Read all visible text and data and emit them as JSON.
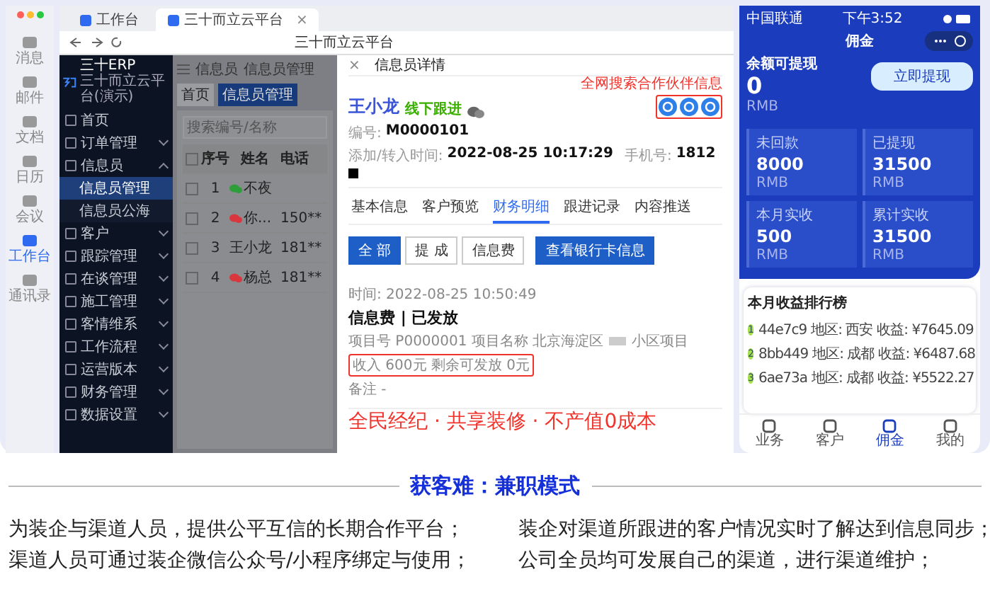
{
  "dock": {
    "items": [
      {
        "label": "消息",
        "selected": false
      },
      {
        "label": "邮件",
        "selected": false
      },
      {
        "label": "文档",
        "selected": false
      },
      {
        "label": "日历",
        "selected": false
      },
      {
        "label": "会议",
        "selected": false
      },
      {
        "label": "工作台",
        "selected": true
      },
      {
        "label": "通讯录",
        "selected": false
      }
    ]
  },
  "browser": {
    "tabs": [
      {
        "label": "工作台",
        "selected": false
      },
      {
        "label": "三十而立云平台",
        "selected": true
      }
    ],
    "tab_close": "×",
    "title": "三十而立云平台"
  },
  "sidebar": {
    "brand": "三十ERP",
    "subtitle": "三十而立云平台(演示)",
    "items": [
      {
        "label": "首页",
        "kind": "link"
      },
      {
        "label": "订单管理",
        "kind": "group",
        "expanded": false
      },
      {
        "label": "信息员",
        "kind": "group",
        "expanded": true,
        "children": [
          {
            "label": "信息员管理",
            "selected": true
          },
          {
            "label": "信息员公海",
            "selected": false
          }
        ]
      },
      {
        "label": "客户",
        "kind": "group",
        "expanded": false
      },
      {
        "label": "跟踪管理",
        "kind": "group",
        "expanded": false
      },
      {
        "label": "在谈管理",
        "kind": "group",
        "expanded": false
      },
      {
        "label": "施工管理",
        "kind": "group",
        "expanded": false
      },
      {
        "label": "客情维系",
        "kind": "group",
        "expanded": false
      },
      {
        "label": "工作流程",
        "kind": "group",
        "expanded": false
      },
      {
        "label": "运营版本",
        "kind": "group",
        "expanded": false
      },
      {
        "label": "财务管理",
        "kind": "group",
        "expanded": false
      },
      {
        "label": "数据设置",
        "kind": "group",
        "expanded": false
      }
    ]
  },
  "content": {
    "breadcrumb": [
      "信息员",
      "信息员管理"
    ],
    "page_tabs": [
      {
        "label": "首页",
        "selected": false
      },
      {
        "label": "信息员管理",
        "selected": true
      }
    ],
    "search": {
      "placeholder": "搜索编号/名称"
    },
    "table": {
      "columns": [
        "序号",
        "姓名",
        "电话"
      ],
      "all_checked": false,
      "rows": [
        {
          "index": "1",
          "name": "不夜",
          "phone": "",
          "color": "#2e9e3a",
          "checked": false
        },
        {
          "index": "2",
          "name": "你...",
          "phone": "150**",
          "color": "#d9363e",
          "checked": false
        },
        {
          "index": "3",
          "name": "王小龙",
          "phone": "181**",
          "checked": false
        },
        {
          "index": "4",
          "name": "杨总",
          "phone": "181**",
          "color": "#d9363e",
          "checked": false
        }
      ]
    }
  },
  "drawer": {
    "title": "信息员详情",
    "close": "×",
    "name": "王小龙",
    "status": "线下跟进",
    "search_note": "全网搜索合作伙伴信息",
    "fields": [
      {
        "label": "编号:",
        "value": "M0000101"
      },
      {
        "label": "添加/转入时间:",
        "value": "2022-08-25 10:17:29"
      },
      {
        "label": "手机号:",
        "value": "1812"
      }
    ],
    "tabs": [
      {
        "label": "基本信息",
        "selected": false
      },
      {
        "label": "客户预览",
        "selected": false
      },
      {
        "label": "财务明细",
        "selected": true
      },
      {
        "label": "跟进记录",
        "selected": false
      },
      {
        "label": "内容推送",
        "selected": false
      }
    ],
    "filters": [
      {
        "label": "全 部",
        "selected": true
      },
      {
        "label": "提 成",
        "selected": false
      },
      {
        "label": "信息费",
        "selected": false
      }
    ],
    "bank_button": "查看银行卡信息",
    "record": {
      "time": "时间: 2022-08-25 10:50:49",
      "title": "信息费 | 已发放",
      "project": "项目号 P0000001  项目名称 北京海淀区",
      "project_type": "小区项目",
      "income": "收入 600元  剩余可发放 0元",
      "note": "备注 -"
    },
    "slogan": "全民经纪 · 共享装修 · 不产值0成本"
  },
  "phone": {
    "carrier": "中国联通",
    "time": "下午3:52",
    "title": "佣金",
    "balance_label": "余额可提现",
    "balance": "0",
    "balance_unit": "RMB",
    "withdraw_button": "立即提现",
    "stats": [
      {
        "label": "未回款",
        "value": "8000",
        "unit": "RMB"
      },
      {
        "label": "已提现",
        "value": "31500",
        "unit": "RMB"
      },
      {
        "label": "本月实收",
        "value": "500",
        "unit": "RMB"
      },
      {
        "label": "累计实收",
        "value": "31500",
        "unit": "RMB"
      }
    ],
    "ranking": {
      "title": "本月收益排行榜",
      "rows": [
        {
          "rank": "1",
          "id": "44e7c9",
          "region": "地区: 西安",
          "income": "收益: ¥7645.09"
        },
        {
          "rank": "2",
          "id": "8bb449",
          "region": "地区: 成都",
          "income": "收益: ¥6487.68"
        },
        {
          "rank": "3",
          "id": "6ae73a",
          "region": "地区: 成都",
          "income": "收益: ¥5522.27"
        }
      ]
    },
    "tabbar": [
      {
        "label": "业务",
        "selected": false
      },
      {
        "label": "客户",
        "selected": false
      },
      {
        "label": "佣金",
        "selected": true
      },
      {
        "label": "我的",
        "selected": false
      }
    ]
  },
  "caption": {
    "heading": "获客难：兼职模式",
    "lines": [
      "为装企与渠道人员，提供公平互信的长期合作平台；",
      "装企对渠道所跟进的客户情况实时了解达到信息同步；",
      "渠道人员可通过装企微信公众号/小程序绑定与使用；",
      "公司全员均可发展自己的渠道，进行渠道维护；"
    ]
  }
}
